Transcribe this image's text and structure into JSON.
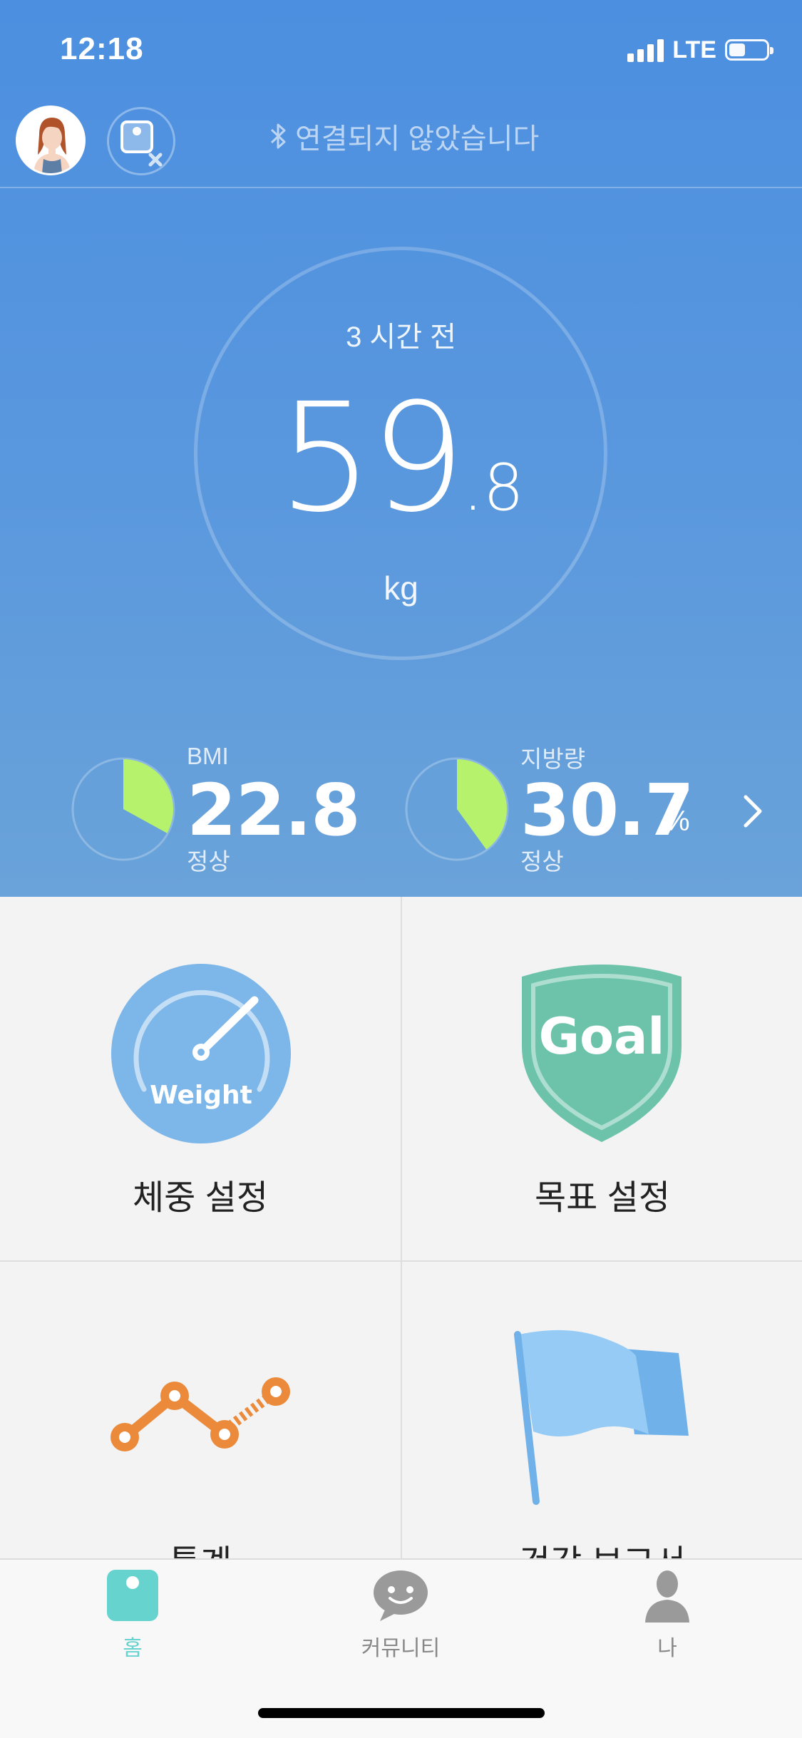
{
  "status_bar": {
    "time": "12:18",
    "network": "LTE"
  },
  "header": {
    "connection_status": "연결되지 않았습니다"
  },
  "measurement": {
    "time_ago": "3 시간 전",
    "weight_int": "59",
    "weight_dec": ".8",
    "unit": "kg"
  },
  "stats": [
    {
      "label": "BMI",
      "value": "22.8",
      "unit": "",
      "status": "정상",
      "pie_fraction": 0.33,
      "pie_color": "#b6f26c"
    },
    {
      "label": "지방량",
      "value": "30.7",
      "unit": "%",
      "status": "정상",
      "pie_fraction": 0.4,
      "pie_color": "#b6f26c"
    }
  ],
  "tiles": {
    "weight_setting": {
      "label": "체중 설정",
      "badge": "Weight"
    },
    "goal_setting": {
      "label": "목표 설정",
      "badge": "Goal"
    },
    "statistics": {
      "label": "통계"
    },
    "health_report": {
      "label": "건강 보고서"
    }
  },
  "tabbar": {
    "items": [
      {
        "label": "홈",
        "icon": "scale-icon",
        "active": true
      },
      {
        "label": "커뮤니티",
        "icon": "chat-bubble-icon",
        "active": false
      },
      {
        "label": "나",
        "icon": "person-icon",
        "active": false
      }
    ]
  },
  "colors": {
    "hero_top": "#4c8fe0",
    "hero_bottom": "#6aa3d9",
    "accent_teal": "#66d3cf",
    "pie_green": "#b6f26c",
    "orange": "#ea8a3a",
    "goal_green": "#6cc3aa"
  }
}
